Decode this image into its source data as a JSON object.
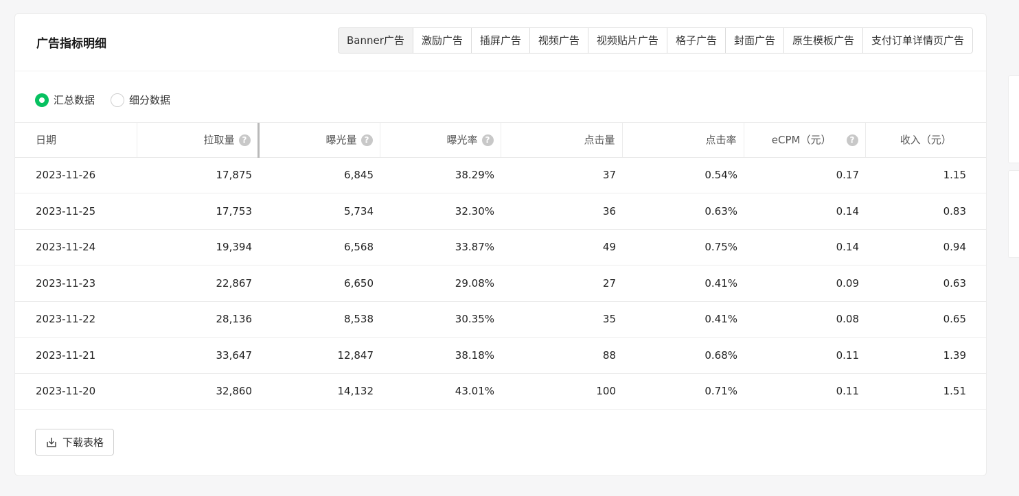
{
  "card": {
    "title": "广告指标明细"
  },
  "tabs": [
    "Banner广告",
    "激励广告",
    "插屏广告",
    "视频广告",
    "视频贴片广告",
    "格子广告",
    "封面广告",
    "原生模板广告",
    "支付订单详情页广告"
  ],
  "active_tab": "Banner广告",
  "radios": {
    "summary": "汇总数据",
    "detail": "细分数据",
    "selected": "汇总数据"
  },
  "table": {
    "headers": [
      "日期",
      "拉取量",
      "曝光量",
      "曝光率",
      "点击量",
      "点击率",
      "eCPM（元）",
      "收入（元）"
    ],
    "rows": [
      [
        "2023-11-26",
        "17,875",
        "6,845",
        "38.29%",
        "37",
        "0.54%",
        "0.17",
        "1.15"
      ],
      [
        "2023-11-25",
        "17,753",
        "5,734",
        "32.30%",
        "36",
        "0.63%",
        "0.14",
        "0.83"
      ],
      [
        "2023-11-24",
        "19,394",
        "6,568",
        "33.87%",
        "49",
        "0.75%",
        "0.14",
        "0.94"
      ],
      [
        "2023-11-23",
        "22,867",
        "6,650",
        "29.08%",
        "27",
        "0.41%",
        "0.09",
        "0.63"
      ],
      [
        "2023-11-22",
        "28,136",
        "8,538",
        "30.35%",
        "35",
        "0.41%",
        "0.08",
        "0.65"
      ],
      [
        "2023-11-21",
        "33,647",
        "12,847",
        "38.18%",
        "88",
        "0.68%",
        "0.11",
        "1.39"
      ],
      [
        "2023-11-20",
        "32,860",
        "14,132",
        "43.01%",
        "100",
        "0.71%",
        "0.11",
        "1.51"
      ]
    ]
  },
  "footer": {
    "download_label": "下载表格"
  },
  "colors": {
    "accent": "#07c160",
    "help_icon": "#c8c8c8"
  }
}
